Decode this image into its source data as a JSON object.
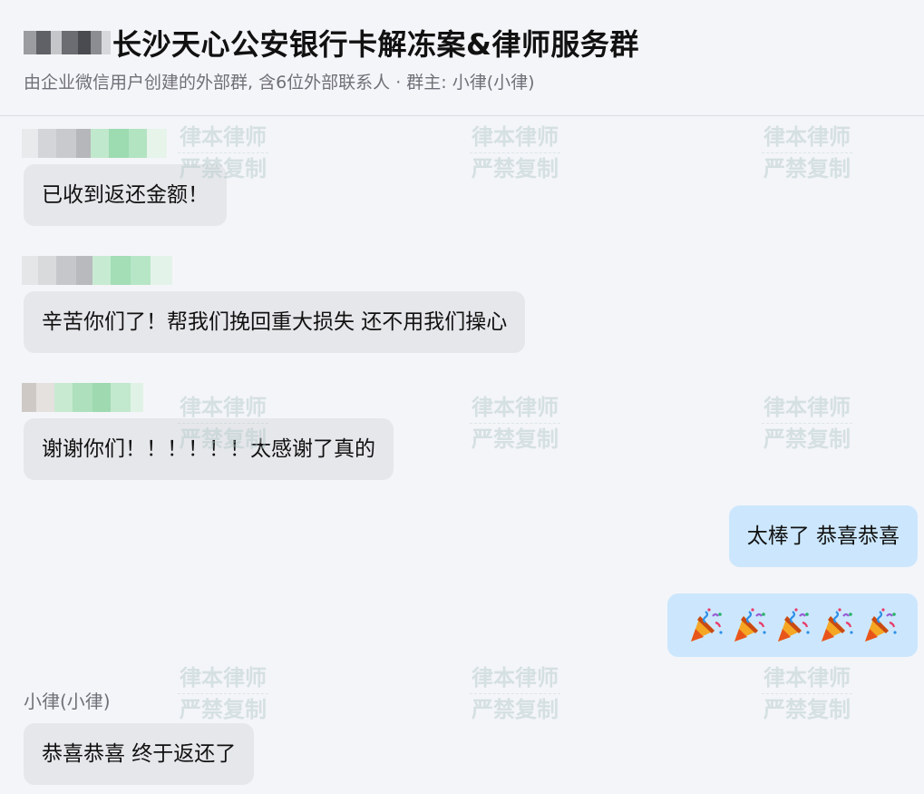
{
  "header": {
    "title": "长沙天心公安银行卡解冻案&律师服务群",
    "subtitle": "由企业微信用户创建的外部群, 含6位外部联系人 · 群主: 小律(小律)"
  },
  "watermark": {
    "line1": "律本律师",
    "line2": "严禁复制"
  },
  "messages": [
    {
      "direction": "incoming",
      "sender_hidden": true,
      "text": "已收到返还金额！"
    },
    {
      "direction": "incoming",
      "sender_hidden": true,
      "text": "辛苦你们了！帮我们挽回重大损失 还不用我们操心"
    },
    {
      "direction": "incoming",
      "sender_hidden": true,
      "text": "谢谢你们！！！！！！太感谢了真的"
    },
    {
      "direction": "outgoing",
      "text": "太棒了 恭喜恭喜"
    },
    {
      "direction": "outgoing",
      "emoji": "party-popper-icon",
      "emoji_count": 5
    },
    {
      "direction": "incoming",
      "sender": "小律(小律)",
      "text": "恭喜恭喜 终于返还了"
    }
  ],
  "colors": {
    "incoming_bubble": "#e6e7eb",
    "outgoing_bubble": "#cce7fd",
    "background": "#f4f5f9",
    "subtitle_text": "#6f7077"
  }
}
